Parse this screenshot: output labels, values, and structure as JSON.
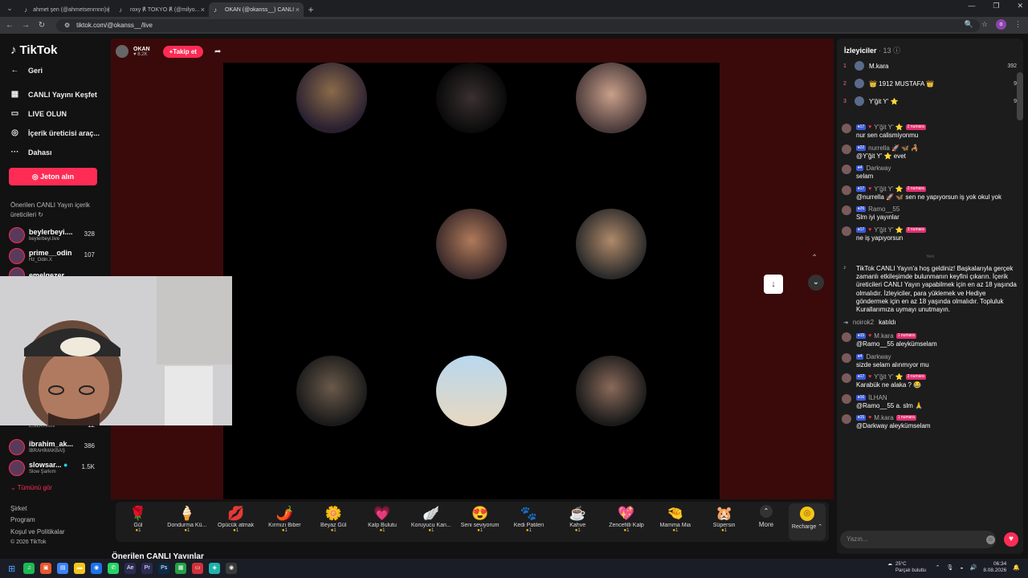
{
  "browser": {
    "tabs": [
      {
        "title": "ahmet şen (@ahmetsenrnnn) |"
      },
      {
        "title": "roxy ℟ TOKYO ℟ (@milyo..."
      },
      {
        "title": "OKAN (@okanss__) CANLI"
      }
    ],
    "url": "tiktok.com/@okanss__/live"
  },
  "sidebar": {
    "logo": "TikTok",
    "nav": [
      {
        "label": "Geri",
        "icon": "back-arrow-icon"
      },
      {
        "label": "CANLI Yayını Keşfet",
        "icon": "live-explore-icon"
      },
      {
        "label": "LIVE OLUN",
        "icon": "camera-icon"
      },
      {
        "label": "İçerik üreticisi araç...",
        "icon": "lightbulb-icon"
      },
      {
        "label": "Dahası",
        "icon": "dots-icon"
      }
    ],
    "jeton_label": "Jeton alın",
    "suggest_heading": "Önerilen CANLI Yayın içerik üreticileri",
    "creators": [
      {
        "name": "beylerbeyi....",
        "sub": "beylerbeyi.live",
        "count": "328"
      },
      {
        "name": "prime__odin",
        "sub": "Hz_Odin.X",
        "count": "107"
      },
      {
        "name": "emelgezer",
        "sub": "",
        "count": ""
      },
      {
        "name": "",
        "sub": "ESİLA AKIN",
        "count": "12"
      },
      {
        "name": "ibrahim_ak...",
        "sub": "İBRAHİMAKBAŞ",
        "count": "386"
      },
      {
        "name": "slowsar...",
        "sub": "Slow Şarkım",
        "count": "1.5K"
      }
    ],
    "more_label": "Tümünü gör",
    "footer": [
      "Şirket",
      "Program",
      "Koşul ve Politikalar",
      "© 2026 TikTok"
    ]
  },
  "stream": {
    "host_name": "OKAN",
    "host_likes": "8.2K",
    "follow_label": "Takip et",
    "gifts": [
      {
        "icon": "🌹",
        "label": "Gül",
        "price": "1"
      },
      {
        "icon": "🍦",
        "label": "Dondurma Kü...",
        "price": "1"
      },
      {
        "icon": "💋",
        "label": "Öpücük atmak",
        "price": "1"
      },
      {
        "icon": "🌶️",
        "label": "Kırmızı Biber",
        "price": "1"
      },
      {
        "icon": "🌼",
        "label": "Beyaz Gül",
        "price": "1"
      },
      {
        "icon": "💗",
        "label": "Kalp Bulutu",
        "price": "1"
      },
      {
        "icon": "🪽",
        "label": "Koruyucu Kan...",
        "price": "1"
      },
      {
        "icon": "😍",
        "label": "Seni seviyorum",
        "price": "1"
      },
      {
        "icon": "🐾",
        "label": "Kedi Patileri",
        "price": "1"
      },
      {
        "icon": "☕",
        "label": "Kahve",
        "price": "1"
      },
      {
        "icon": "💖",
        "label": "Zencefilli Kalp",
        "price": "1"
      },
      {
        "icon": "🤏",
        "label": "Mamma Mia",
        "price": "1"
      },
      {
        "icon": "🐹",
        "label": "Süpersin",
        "price": "1"
      }
    ],
    "more_label": "More",
    "recharge_label": "Recharge",
    "suggested_title": "Önerilen CANLI Yayınlar"
  },
  "viewers": {
    "heading": "İzleyiciler",
    "count": "· 13",
    "top": [
      {
        "rank": "1",
        "name": "M.kara",
        "score": "392"
      },
      {
        "rank": "2",
        "name": "👑 1912 MUSTAFA 👑",
        "score": "9"
      },
      {
        "rank": "3",
        "name": "Y'ğit Y' ⭐",
        "score": "9"
      }
    ]
  },
  "chat": {
    "messages": [
      {
        "lvl": "17",
        "user": "Y'ğit Y' ⭐",
        "badge": "2 numara",
        "text": "nur sen calismiyonmu"
      },
      {
        "lvl": "22",
        "user": "nurrella 🚀 🦋 🦂",
        "badge": "",
        "text": "@Y'ğit Y' ⭐  evet"
      },
      {
        "lvl": "4",
        "user": "Darkway",
        "badge": "",
        "text": "selam"
      },
      {
        "lvl": "17",
        "user": "Y'ğit Y' ⭐",
        "badge": "2 numara",
        "text": "@nurrella 🚀 🦋  sen ne yapıyorsun iş yok okul yok"
      },
      {
        "lvl": "26",
        "user": "Ramo__55",
        "badge": "",
        "text": "Slm iyi yayınlar"
      },
      {
        "lvl": "17",
        "user": "Y'ğit Y' ⭐",
        "badge": "3 numara",
        "text": "ne iş yapıyorsun"
      }
    ],
    "new_divider": "Yeni",
    "system": "TikTok CANLI Yayın'a hoş geldiniz! Başkalarıyla gerçek zamanlı etkileşimde bulunmanın keyfini çıkarın. İçerik üreticileri CANLI Yayın yapabilmek için en az 18 yaşında olmalıdır. İzleyiciler, para yüklemek ve Hediye göndermek için en az 18 yaşında olmalıdır. Topluluk Kurallarımıza uymayı unutmayın.",
    "joined_user": "noirok2",
    "joined_text": "katıldı",
    "messages2": [
      {
        "lvl": "15",
        "user": "M.kara",
        "badge": "1 numara",
        "text": "@Ramo__55 aleykümselam"
      },
      {
        "lvl": "4",
        "user": "Darkway",
        "badge": "",
        "text": "sizde selam alınmıyor mu"
      },
      {
        "lvl": "17",
        "user": "Y'ğit Y' ⭐",
        "badge": "3 numara",
        "text": "Karabük ne alaka ? 😂"
      },
      {
        "lvl": "16",
        "user": "İLHAN",
        "badge": "",
        "text": "@Ramo__55 a. slm 🙏"
      },
      {
        "lvl": "15",
        "user": "M.kara",
        "badge": "1 numara",
        "text": "@Darkway aleykümselam"
      }
    ],
    "input_placeholder": "Yazın..."
  },
  "taskbar": {
    "weather_temp": "25°C",
    "weather_desc": "Parçalı bulutlu",
    "time": "06:34",
    "date": "8.08.2026"
  }
}
